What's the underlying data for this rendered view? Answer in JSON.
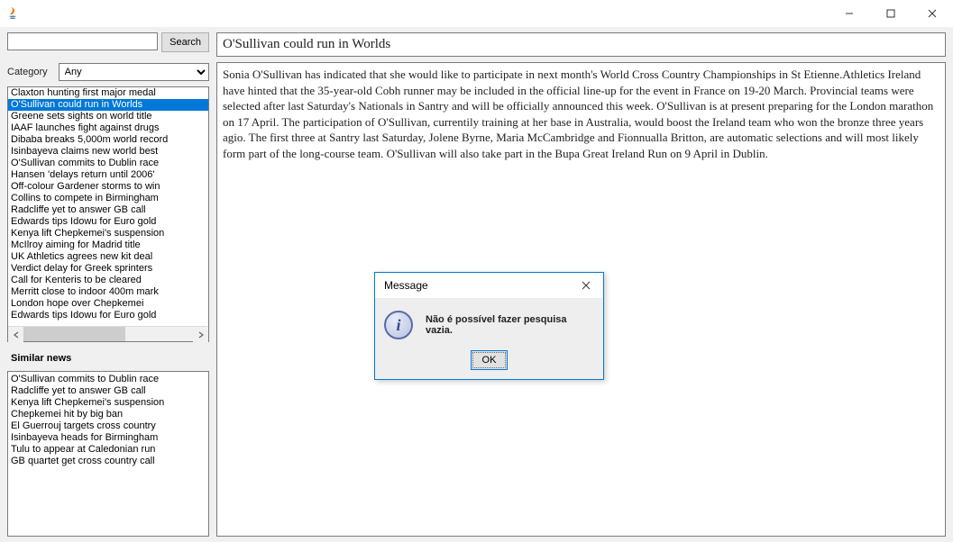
{
  "window": {
    "title": ""
  },
  "search": {
    "input_value": "",
    "placeholder": "",
    "button_label": "Search"
  },
  "category": {
    "label": "Category",
    "selected": "Any"
  },
  "news_list": {
    "selected_index": 1,
    "items": [
      "Claxton hunting first major medal",
      "O'Sullivan could run in Worlds",
      "Greene sets sights on world title",
      "IAAF launches fight against drugs",
      "Dibaba breaks 5,000m world record",
      "Isinbayeva claims new world best",
      "O'Sullivan commits to Dublin race",
      "Hansen 'delays return until 2006'",
      "Off-colour Gardener storms to win",
      "Collins to compete in Birmingham",
      "Radcliffe yet to answer GB call",
      "Edwards tips Idowu for Euro gold",
      "Kenya lift Chepkemei's suspension",
      "McIlroy aiming for Madrid title",
      "UK Athletics agrees new kit deal",
      "Verdict delay for Greek sprinters",
      "Call for Kenteris to be cleared",
      "Merritt close to indoor 400m mark",
      "London hope over Chepkemei",
      "Edwards tips Idowu for Euro gold"
    ]
  },
  "similar": {
    "label": "Similar news",
    "items": [
      "O'Sullivan commits to Dublin race",
      "Radcliffe yet to answer GB call",
      "Kenya lift Chepkemei's suspension",
      "Chepkemei hit by big ban",
      "El Guerrouj targets cross country",
      "Isinbayeva heads for Birmingham",
      "Tulu to appear at Caledonian run",
      "GB quartet get cross country call"
    ]
  },
  "article": {
    "title": "O'Sullivan could run in Worlds",
    "body": "Sonia O'Sullivan has indicated that she would like to participate in next month's World Cross Country Championships in St Etienne.Athletics Ireland have hinted that the 35-year-old Cobh runner may be included in the official line-up for the event in France on 19-20 March. Provincial teams were selected after last Saturday's Nationals in Santry and will be officially announced this week. O'Sullivan is at present preparing for the London marathon on 17 April. The participation of O'Sullivan, currentily training at her base in Australia, would boost the Ireland team who won the bronze three years agio. The first three at Santry last Saturday, Jolene Byrne, Maria McCambridge and Fionnualla Britton, are automatic selections and will most likely form part of the long-course team. O'Sullivan will also take part in the Bupa Great Ireland Run on 9 April in Dublin."
  },
  "dialog": {
    "title": "Message",
    "text": "Não é possível fazer pesquisa vazia.",
    "ok_label": "OK"
  }
}
